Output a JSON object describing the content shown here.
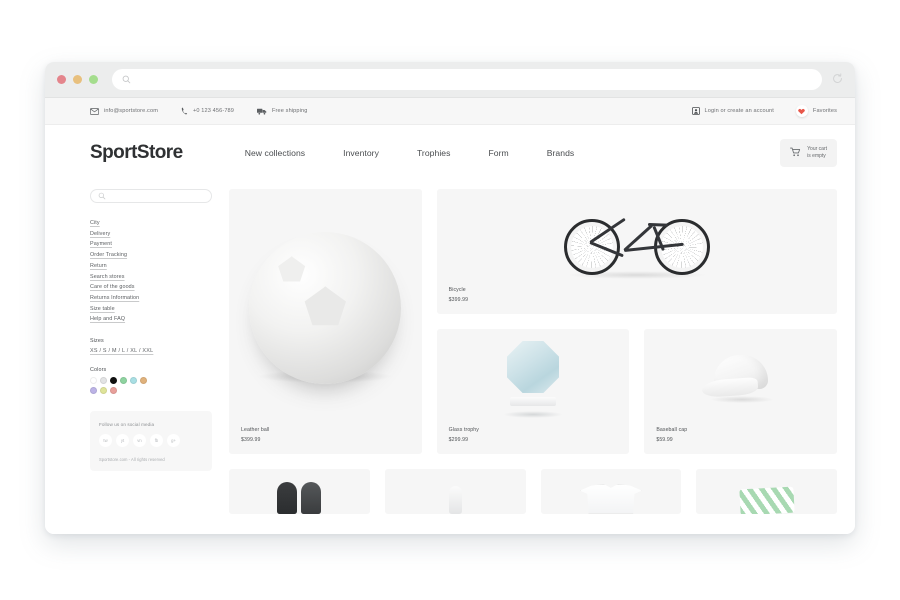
{
  "browser": {
    "url_placeholder": "",
    "search_icon": "search-icon",
    "reload_icon": "reload-icon"
  },
  "topbar": {
    "email": "info@sportstore.com",
    "phone": "+0 123 456-789",
    "shipping": "Free shipping",
    "login": "Login or create an account",
    "favorites": "Favorites"
  },
  "header": {
    "logo": "SportStore",
    "nav": [
      {
        "label": "New collections"
      },
      {
        "label": "Inventory"
      },
      {
        "label": "Trophies"
      },
      {
        "label": "Form"
      },
      {
        "label": "Brands"
      }
    ],
    "cart": {
      "line1": "Your cart",
      "line2": "is empty"
    }
  },
  "sidebar": {
    "search_placeholder": "",
    "links": [
      {
        "label": "City"
      },
      {
        "label": "Delivery"
      },
      {
        "label": "Payment"
      },
      {
        "label": "Order Tracking"
      },
      {
        "label": "Return"
      },
      {
        "label": "Search stores"
      },
      {
        "label": "Care of the goods"
      },
      {
        "label": "Returns Information"
      },
      {
        "label": "Size table"
      },
      {
        "label": "Help and FAQ"
      }
    ],
    "sizes_title": "Sizes",
    "sizes_value": "XS / S / M / L / XL / XXL",
    "colors_title": "Colors",
    "colors": [
      "#ffffff",
      "#e3e4e5",
      "#111111",
      "#8fd3a0",
      "#a9dfe4",
      "#e0b27c",
      "#bcb3e6",
      "#dfe49a",
      "#e8a09b"
    ],
    "social": {
      "title": "Follow us on social media",
      "icons": [
        {
          "label": "tw"
        },
        {
          "label": "yt"
        },
        {
          "label": "vn"
        },
        {
          "label": "fb"
        },
        {
          "label": "g+"
        }
      ],
      "copyright": "Sportstore.com - All rights reserved"
    }
  },
  "products": {
    "featured": {
      "name": "Leather ball",
      "price": "$399.99",
      "art": "soccer-ball"
    },
    "bicycle": {
      "name": "Bicycle",
      "price": "$399.99",
      "art": "bicycle"
    },
    "trophy": {
      "name": "Glass trophy",
      "price": "$299.99",
      "art": "glass-trophy"
    },
    "cap": {
      "name": "Baseball cap",
      "price": "$59.99",
      "art": "baseball-cap"
    },
    "partial": [
      {
        "art": "boxing-gloves"
      },
      {
        "art": "water-bottle"
      },
      {
        "art": "t-shirt"
      },
      {
        "art": "striped-towel"
      }
    ]
  }
}
